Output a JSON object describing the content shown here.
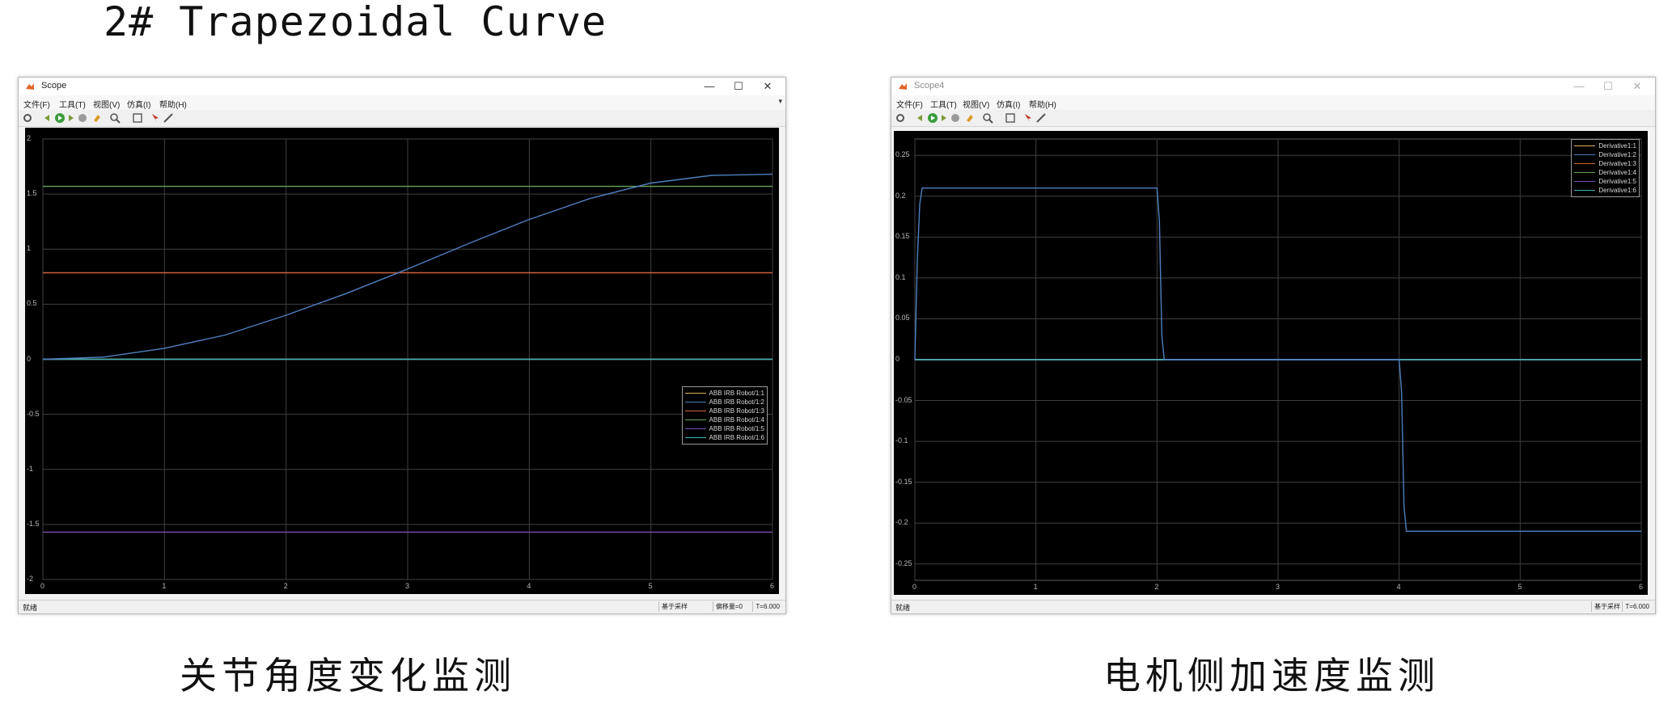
{
  "page_title": "2# Trapezoidal Curve",
  "captions": {
    "left": "关节角度变化监测",
    "right": "电机侧加速度监测"
  },
  "colors": {
    "plot_bg": "#000000",
    "grid": "#404040",
    "tick_label": "#b8b8b8",
    "series_1": "#ddb35f",
    "series_2": "#4f7fc0",
    "series_3": "#d0623a",
    "series_4": "#67a35a",
    "series_5": "#7a4fb2",
    "series_6": "#3fb3b8"
  },
  "windows": [
    {
      "title": "Scope",
      "menus": [
        "文件(F)",
        "工具(T)",
        "视图(V)",
        "仿真(I)",
        "帮助(H)"
      ],
      "toolbar_icons": [
        "settings-icon",
        "step-back-icon",
        "run-icon",
        "step-forward-icon",
        "stop-icon",
        "highlight-icon",
        "zoom-icon",
        "fit-icon",
        "cursor-icon",
        "style-icon"
      ],
      "status": {
        "left": "就绪",
        "mode": "基于采样",
        "offset": "偏移量=0",
        "time": "T=6.000"
      },
      "chart_data": {
        "type": "line",
        "xlim": [
          0,
          6
        ],
        "ylim": [
          -2,
          2
        ],
        "x_ticks": [
          "0",
          "1",
          "2",
          "3",
          "4",
          "5",
          "6"
        ],
        "y_ticks": [
          "2",
          "1.5",
          "1",
          "0.5",
          "0",
          "-0.5",
          "-1",
          "-1.5",
          "-2"
        ],
        "y_tick_values": [
          2,
          1.5,
          1,
          0.5,
          0,
          -0.5,
          -1,
          -1.5,
          -2
        ],
        "grid": true,
        "legend_position": "middle-right",
        "series": [
          {
            "name": "ABB IRB Robot/1:1",
            "color_key": "series_1",
            "points": [
              [
                0,
                0
              ],
              [
                6,
                0
              ]
            ]
          },
          {
            "name": "ABB IRB Robot/1:2",
            "color_key": "series_2",
            "points": [
              [
                0,
                0
              ],
              [
                0.5,
                0.02
              ],
              [
                1,
                0.1
              ],
              [
                1.5,
                0.22
              ],
              [
                2,
                0.4
              ],
              [
                2.5,
                0.6
              ],
              [
                3,
                0.82
              ],
              [
                3.5,
                1.05
              ],
              [
                4,
                1.27
              ],
              [
                4.5,
                1.46
              ],
              [
                5,
                1.6
              ],
              [
                5.5,
                1.67
              ],
              [
                6,
                1.68
              ]
            ]
          },
          {
            "name": "ABB IRB Robot/1:3",
            "color_key": "series_3",
            "points": [
              [
                0,
                0.785
              ],
              [
                6,
                0.785
              ]
            ]
          },
          {
            "name": "ABB IRB Robot/1:4",
            "color_key": "series_4",
            "points": [
              [
                0,
                1.57
              ],
              [
                6,
                1.57
              ]
            ]
          },
          {
            "name": "ABB IRB Robot/1:5",
            "color_key": "series_5",
            "points": [
              [
                0,
                -1.57
              ],
              [
                6,
                -1.57
              ]
            ]
          },
          {
            "name": "ABB IRB Robot/1:6",
            "color_key": "series_6",
            "points": [
              [
                0,
                0
              ],
              [
                6,
                0
              ]
            ]
          }
        ]
      }
    },
    {
      "title": "Scope4",
      "menus": [
        "文件(F)",
        "工具(T)",
        "视图(V)",
        "仿真(I)",
        "帮助(H)"
      ],
      "toolbar_icons": [
        "settings-icon",
        "step-back-icon",
        "run-icon",
        "step-forward-icon",
        "stop-icon",
        "highlight-icon",
        "zoom-icon",
        "fit-icon",
        "cursor-icon",
        "style-icon"
      ],
      "status": {
        "left": "就绪",
        "mode": "基于采样",
        "time": "T=6.000"
      },
      "chart_data": {
        "type": "line",
        "xlim": [
          0,
          6
        ],
        "ylim": [
          -0.27,
          0.27
        ],
        "x_ticks": [
          "0",
          "1",
          "2",
          "3",
          "4",
          "5",
          "6"
        ],
        "y_ticks": [
          "0.25",
          "0.2",
          "0.15",
          "0.1",
          "0.05",
          "0",
          "-0.05",
          "-0.1",
          "-0.15",
          "-0.2",
          "-0.25"
        ],
        "y_tick_values": [
          0.25,
          0.2,
          0.15,
          0.1,
          0.05,
          0,
          -0.05,
          -0.1,
          -0.15,
          -0.2,
          -0.25
        ],
        "grid": true,
        "legend_position": "top-right",
        "series": [
          {
            "name": "Derivative1:1",
            "color_key": "series_1",
            "points": [
              [
                0,
                0
              ],
              [
                6,
                0
              ]
            ]
          },
          {
            "name": "Derivative1:2",
            "color_key": "series_2",
            "points": [
              [
                0,
                0
              ],
              [
                0.02,
                0.12
              ],
              [
                0.04,
                0.19
              ],
              [
                0.06,
                0.21
              ],
              [
                2.0,
                0.21
              ],
              [
                2.02,
                0.17
              ],
              [
                2.04,
                0.03
              ],
              [
                2.06,
                0
              ],
              [
                4.0,
                0
              ],
              [
                4.02,
                -0.04
              ],
              [
                4.04,
                -0.18
              ],
              [
                4.06,
                -0.21
              ],
              [
                6,
                -0.21
              ]
            ]
          },
          {
            "name": "Derivative1:3",
            "color_key": "series_3",
            "points": [
              [
                0,
                0
              ],
              [
                6,
                0
              ]
            ]
          },
          {
            "name": "Derivative1:4",
            "color_key": "series_4",
            "points": [
              [
                0,
                0
              ],
              [
                6,
                0
              ]
            ]
          },
          {
            "name": "Derivative1:5",
            "color_key": "series_5",
            "points": [
              [
                0,
                0
              ],
              [
                6,
                0
              ]
            ]
          },
          {
            "name": "Derivative1:6",
            "color_key": "series_6",
            "points": [
              [
                0,
                0
              ],
              [
                6,
                0
              ]
            ]
          }
        ]
      }
    }
  ]
}
